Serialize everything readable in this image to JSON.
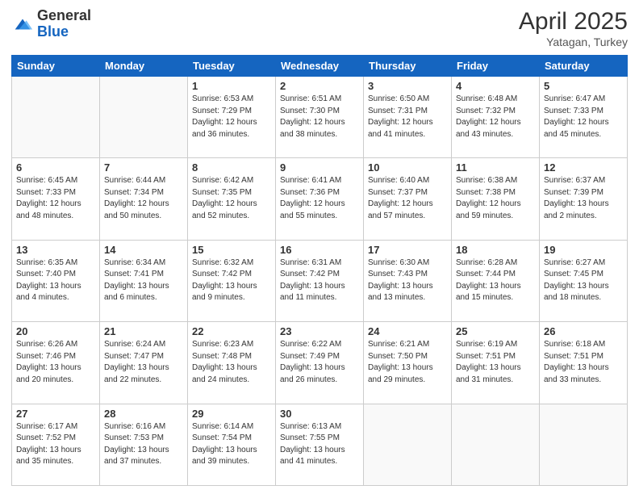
{
  "header": {
    "logo_general": "General",
    "logo_blue": "Blue",
    "title": "April 2025",
    "location": "Yatagan, Turkey"
  },
  "days_of_week": [
    "Sunday",
    "Monday",
    "Tuesday",
    "Wednesday",
    "Thursday",
    "Friday",
    "Saturday"
  ],
  "weeks": [
    [
      {
        "day": "",
        "info": ""
      },
      {
        "day": "",
        "info": ""
      },
      {
        "day": "1",
        "info": "Sunrise: 6:53 AM\nSunset: 7:29 PM\nDaylight: 12 hours and 36 minutes."
      },
      {
        "day": "2",
        "info": "Sunrise: 6:51 AM\nSunset: 7:30 PM\nDaylight: 12 hours and 38 minutes."
      },
      {
        "day": "3",
        "info": "Sunrise: 6:50 AM\nSunset: 7:31 PM\nDaylight: 12 hours and 41 minutes."
      },
      {
        "day": "4",
        "info": "Sunrise: 6:48 AM\nSunset: 7:32 PM\nDaylight: 12 hours and 43 minutes."
      },
      {
        "day": "5",
        "info": "Sunrise: 6:47 AM\nSunset: 7:33 PM\nDaylight: 12 hours and 45 minutes."
      }
    ],
    [
      {
        "day": "6",
        "info": "Sunrise: 6:45 AM\nSunset: 7:33 PM\nDaylight: 12 hours and 48 minutes."
      },
      {
        "day": "7",
        "info": "Sunrise: 6:44 AM\nSunset: 7:34 PM\nDaylight: 12 hours and 50 minutes."
      },
      {
        "day": "8",
        "info": "Sunrise: 6:42 AM\nSunset: 7:35 PM\nDaylight: 12 hours and 52 minutes."
      },
      {
        "day": "9",
        "info": "Sunrise: 6:41 AM\nSunset: 7:36 PM\nDaylight: 12 hours and 55 minutes."
      },
      {
        "day": "10",
        "info": "Sunrise: 6:40 AM\nSunset: 7:37 PM\nDaylight: 12 hours and 57 minutes."
      },
      {
        "day": "11",
        "info": "Sunrise: 6:38 AM\nSunset: 7:38 PM\nDaylight: 12 hours and 59 minutes."
      },
      {
        "day": "12",
        "info": "Sunrise: 6:37 AM\nSunset: 7:39 PM\nDaylight: 13 hours and 2 minutes."
      }
    ],
    [
      {
        "day": "13",
        "info": "Sunrise: 6:35 AM\nSunset: 7:40 PM\nDaylight: 13 hours and 4 minutes."
      },
      {
        "day": "14",
        "info": "Sunrise: 6:34 AM\nSunset: 7:41 PM\nDaylight: 13 hours and 6 minutes."
      },
      {
        "day": "15",
        "info": "Sunrise: 6:32 AM\nSunset: 7:42 PM\nDaylight: 13 hours and 9 minutes."
      },
      {
        "day": "16",
        "info": "Sunrise: 6:31 AM\nSunset: 7:42 PM\nDaylight: 13 hours and 11 minutes."
      },
      {
        "day": "17",
        "info": "Sunrise: 6:30 AM\nSunset: 7:43 PM\nDaylight: 13 hours and 13 minutes."
      },
      {
        "day": "18",
        "info": "Sunrise: 6:28 AM\nSunset: 7:44 PM\nDaylight: 13 hours and 15 minutes."
      },
      {
        "day": "19",
        "info": "Sunrise: 6:27 AM\nSunset: 7:45 PM\nDaylight: 13 hours and 18 minutes."
      }
    ],
    [
      {
        "day": "20",
        "info": "Sunrise: 6:26 AM\nSunset: 7:46 PM\nDaylight: 13 hours and 20 minutes."
      },
      {
        "day": "21",
        "info": "Sunrise: 6:24 AM\nSunset: 7:47 PM\nDaylight: 13 hours and 22 minutes."
      },
      {
        "day": "22",
        "info": "Sunrise: 6:23 AM\nSunset: 7:48 PM\nDaylight: 13 hours and 24 minutes."
      },
      {
        "day": "23",
        "info": "Sunrise: 6:22 AM\nSunset: 7:49 PM\nDaylight: 13 hours and 26 minutes."
      },
      {
        "day": "24",
        "info": "Sunrise: 6:21 AM\nSunset: 7:50 PM\nDaylight: 13 hours and 29 minutes."
      },
      {
        "day": "25",
        "info": "Sunrise: 6:19 AM\nSunset: 7:51 PM\nDaylight: 13 hours and 31 minutes."
      },
      {
        "day": "26",
        "info": "Sunrise: 6:18 AM\nSunset: 7:51 PM\nDaylight: 13 hours and 33 minutes."
      }
    ],
    [
      {
        "day": "27",
        "info": "Sunrise: 6:17 AM\nSunset: 7:52 PM\nDaylight: 13 hours and 35 minutes."
      },
      {
        "day": "28",
        "info": "Sunrise: 6:16 AM\nSunset: 7:53 PM\nDaylight: 13 hours and 37 minutes."
      },
      {
        "day": "29",
        "info": "Sunrise: 6:14 AM\nSunset: 7:54 PM\nDaylight: 13 hours and 39 minutes."
      },
      {
        "day": "30",
        "info": "Sunrise: 6:13 AM\nSunset: 7:55 PM\nDaylight: 13 hours and 41 minutes."
      },
      {
        "day": "",
        "info": ""
      },
      {
        "day": "",
        "info": ""
      },
      {
        "day": "",
        "info": ""
      }
    ]
  ]
}
